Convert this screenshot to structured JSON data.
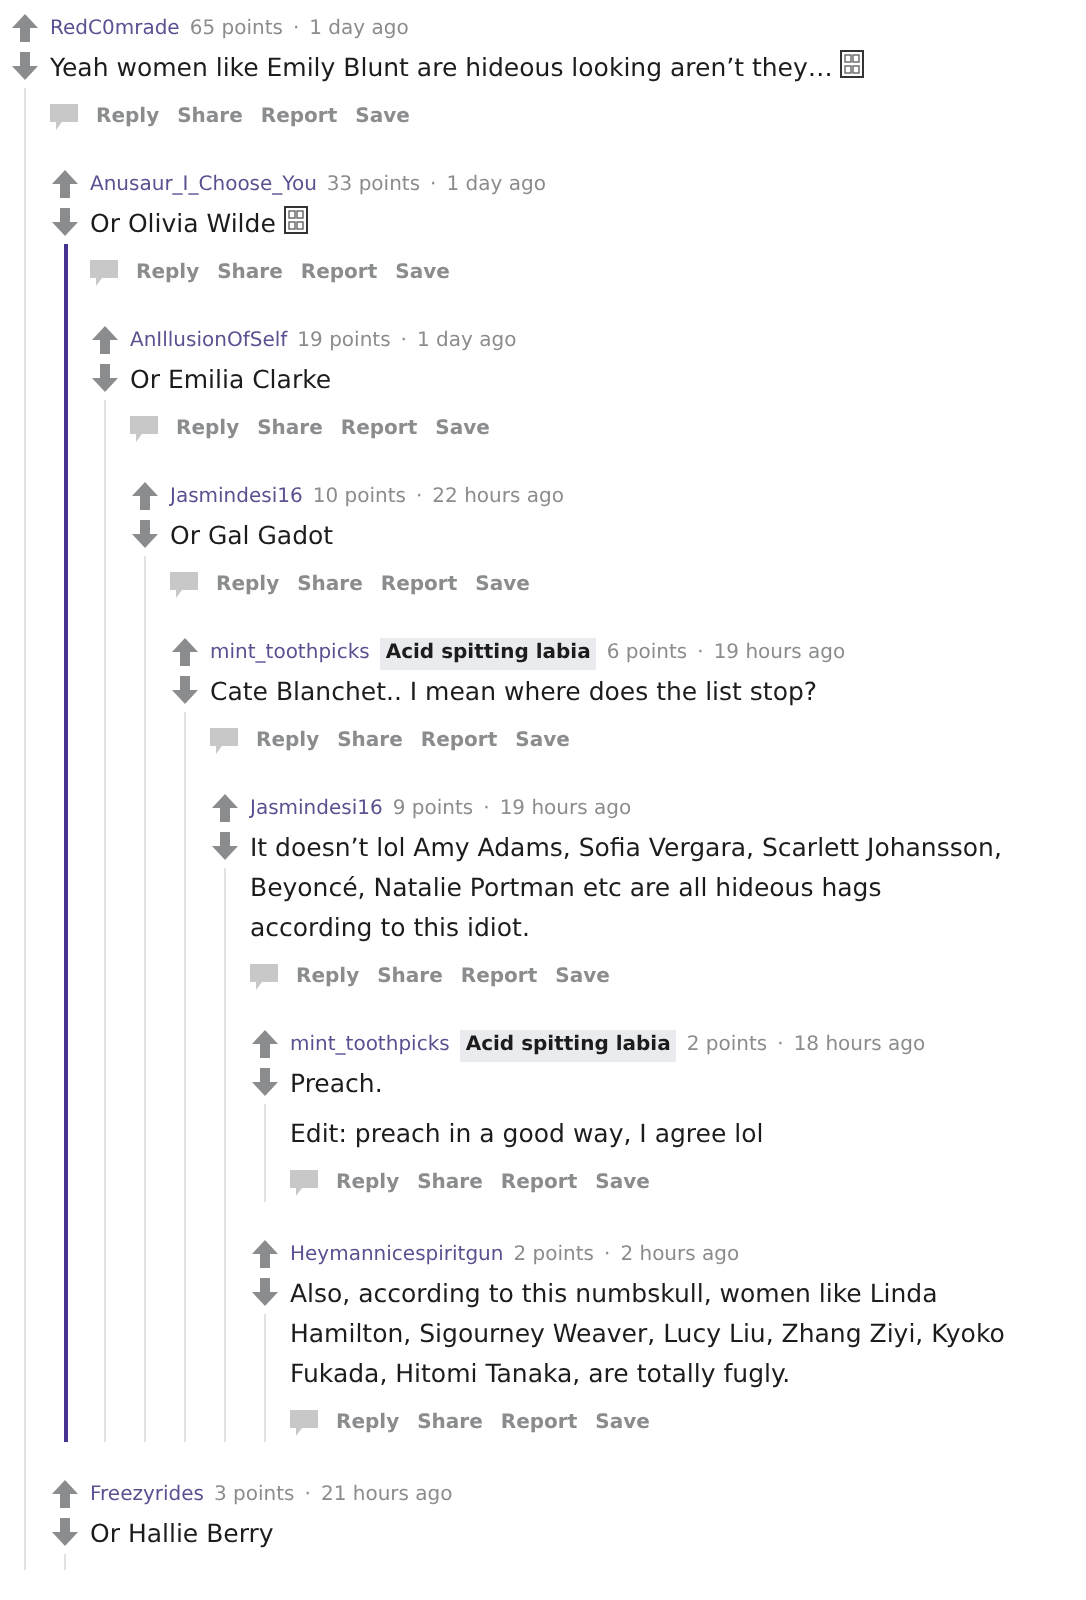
{
  "comments": [
    {
      "author": "RedC0mrade",
      "points": "65 points",
      "separator": "·",
      "time": "1 day ago",
      "body": [
        "Yeah women like Emily Blunt are hideous looking aren’t they…"
      ],
      "trailing_glyph": true,
      "thread_highlighted": false,
      "actions": [
        "Reply",
        "Share",
        "Report",
        "Save"
      ],
      "children": [
        {
          "author": "Anusaur_I_Choose_You",
          "points": "33 points",
          "separator": "·",
          "time": "1 day ago",
          "body": [
            "Or Olivia Wilde"
          ],
          "trailing_glyph": true,
          "thread_highlighted": true,
          "actions": [
            "Reply",
            "Share",
            "Report",
            "Save"
          ],
          "children": [
            {
              "author": "AnIllusionOfSelf",
              "points": "19 points",
              "separator": "·",
              "time": "1 day ago",
              "body": [
                "Or Emilia Clarke"
              ],
              "trailing_glyph": false,
              "thread_highlighted": false,
              "actions": [
                "Reply",
                "Share",
                "Report",
                "Save"
              ],
              "children": [
                {
                  "author": "Jasmindesi16",
                  "points": "10 points",
                  "separator": "·",
                  "time": "22 hours ago",
                  "body": [
                    "Or Gal Gadot"
                  ],
                  "trailing_glyph": false,
                  "thread_highlighted": false,
                  "actions": [
                    "Reply",
                    "Share",
                    "Report",
                    "Save"
                  ],
                  "children": [
                    {
                      "author": "mint_toothpicks",
                      "flair": "Acid spitting labia",
                      "points": "6 points",
                      "separator": "·",
                      "time": "19 hours ago",
                      "body": [
                        "Cate Blanchet.. I mean where does the list stop?"
                      ],
                      "trailing_glyph": false,
                      "thread_highlighted": false,
                      "actions": [
                        "Reply",
                        "Share",
                        "Report",
                        "Save"
                      ],
                      "children": [
                        {
                          "author": "Jasmindesi16",
                          "points": "9 points",
                          "separator": "·",
                          "time": "19 hours ago",
                          "body": [
                            "It doesn’t lol Amy Adams, Sofia Vergara, Scarlett Johansson, Beyoncé, Natalie Portman etc are all hideous hags according to this idiot."
                          ],
                          "trailing_glyph": false,
                          "thread_highlighted": false,
                          "actions": [
                            "Reply",
                            "Share",
                            "Report",
                            "Save"
                          ],
                          "children": [
                            {
                              "author": "mint_toothpicks",
                              "flair": "Acid spitting labia",
                              "points": "2 points",
                              "separator": "·",
                              "time": "18 hours ago",
                              "body": [
                                "Preach.",
                                "Edit: preach in a good way, I agree lol"
                              ],
                              "trailing_glyph": false,
                              "thread_highlighted": false,
                              "actions": [
                                "Reply",
                                "Share",
                                "Report",
                                "Save"
                              ]
                            },
                            {
                              "author": "Heymannicespiritgun",
                              "points": "2 points",
                              "separator": "·",
                              "time": "2 hours ago",
                              "body": [
                                "Also, according to this numbskull, women like Linda Hamilton, Sigourney Weaver, Lucy Liu, Zhang Ziyi, Kyoko Fukada, Hitomi Tanaka, are totally fugly."
                              ],
                              "trailing_glyph": false,
                              "thread_highlighted": false,
                              "actions": [
                                "Reply",
                                "Share",
                                "Report",
                                "Save"
                              ]
                            }
                          ]
                        }
                      ]
                    }
                  ]
                }
              ]
            }
          ]
        },
        {
          "author": "Freezyrides",
          "points": "3 points",
          "separator": "·",
          "time": "21 hours ago",
          "body": [
            "Or Hallie Berry"
          ],
          "trailing_glyph": false,
          "thread_highlighted": false
        }
      ]
    }
  ]
}
